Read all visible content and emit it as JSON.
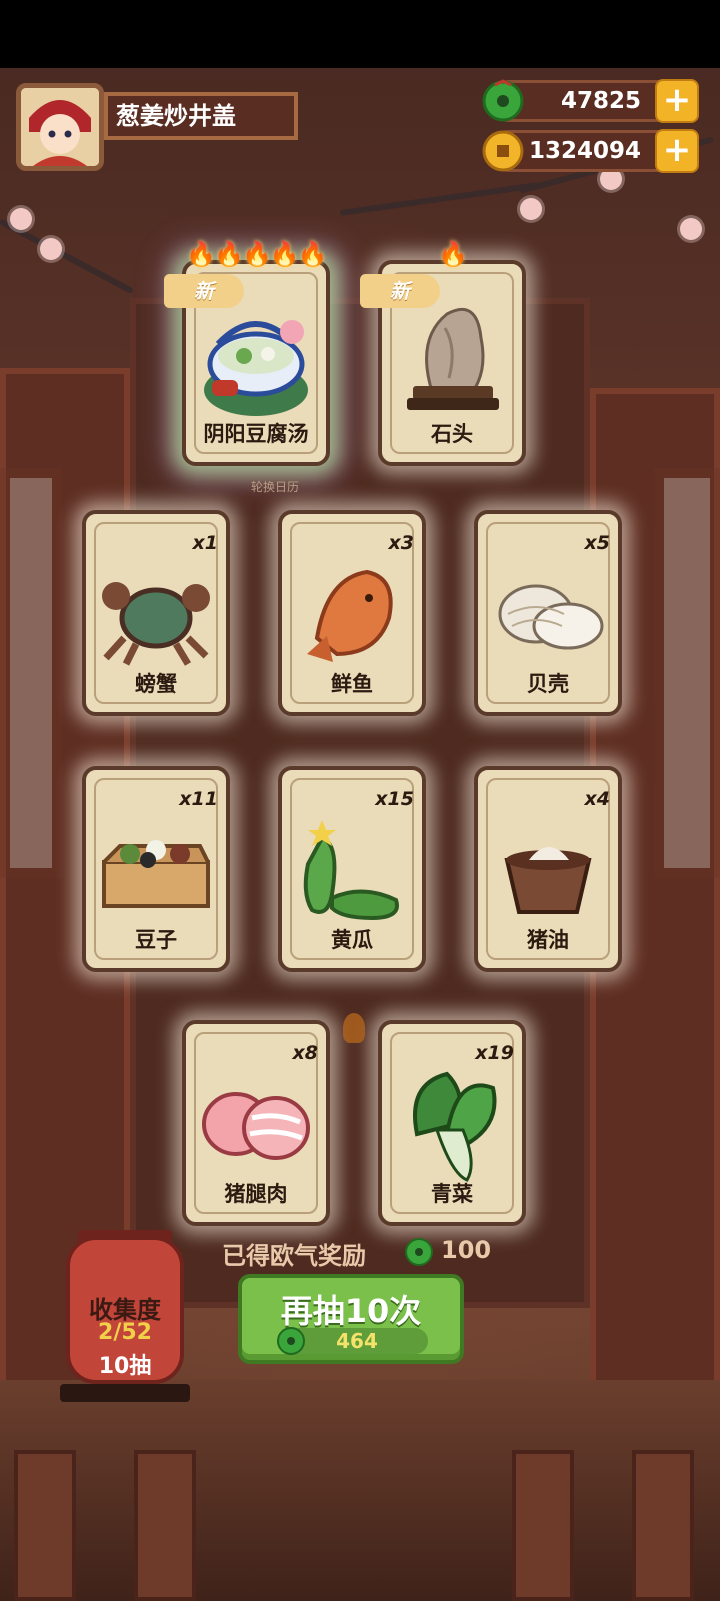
{
  "header": {
    "dish_name": "葱姜炒井盖",
    "currency_jade": "47825",
    "currency_coin": "1324094"
  },
  "featured": [
    {
      "name": "阴阳豆腐汤",
      "badge": "新",
      "flames": "🔥🔥🔥🔥🔥",
      "icon": "tofu-soup-pot-icon"
    },
    {
      "name": "石头",
      "badge": "新",
      "flames": "🔥",
      "icon": "stone-ornament-icon"
    }
  ],
  "featured_caption": "轮换日历",
  "items": [
    {
      "name": "螃蟹",
      "qty": "x1",
      "icon": "crab-icon"
    },
    {
      "name": "鲜鱼",
      "qty": "x3",
      "icon": "fish-icon"
    },
    {
      "name": "贝壳",
      "qty": "x5",
      "icon": "shell-icon"
    },
    {
      "name": "豆子",
      "qty": "x11",
      "icon": "beans-box-icon"
    },
    {
      "name": "黄瓜",
      "qty": "x15",
      "icon": "cucumber-icon"
    },
    {
      "name": "猪油",
      "qty": "x4",
      "icon": "lard-bowl-icon"
    },
    {
      "name": "猪腿肉",
      "qty": "x8",
      "icon": "pork-leg-icon"
    },
    {
      "name": "青菜",
      "qty": "x19",
      "icon": "greens-icon"
    }
  ],
  "reward": {
    "label": "已得欧气奖励",
    "value": "100"
  },
  "draw_button": {
    "label": "再抽10次",
    "cost": "464"
  },
  "collection": {
    "title": "收集度",
    "progress": "2/52",
    "draws": "10抽"
  },
  "colors": {
    "jade": "#3aa53a",
    "coin": "#f2b52a",
    "button_green": "#7bc04a",
    "card_bg": "#eadbb9"
  }
}
